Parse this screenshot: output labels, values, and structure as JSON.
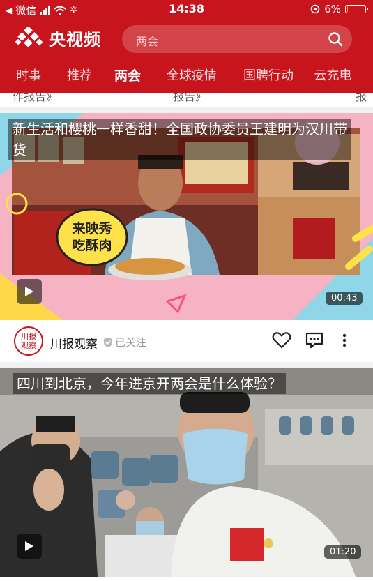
{
  "status_bar": {
    "carrier": "微信",
    "time": "14:38",
    "battery_text": "6%",
    "battery_level_percent": 6
  },
  "header": {
    "app_name": "央视频",
    "search_placeholder": "两会",
    "brand_color": "#c8141d"
  },
  "nav": {
    "tabs": [
      {
        "label": "时事",
        "active": false
      },
      {
        "label": "推荐",
        "active": false
      },
      {
        "label": "两会",
        "active": true
      },
      {
        "label": "全球疫情",
        "active": false
      },
      {
        "label": "国聘行动",
        "active": false
      },
      {
        "label": "云充电",
        "active": false
      }
    ]
  },
  "feed": {
    "partial_texts": [
      "作报告》",
      "报告》",
      "报"
    ],
    "video1": {
      "title": "新生活和樱桃一样香甜！全国政协委员王建明为汉川带货",
      "sticker": "来映秀吃酥肉",
      "duration": "00:43"
    },
    "channel": {
      "name": "川报观察",
      "avatar_text": "川报观察",
      "follow_status": "已关注"
    },
    "video2": {
      "title": "四川到北京，今年进京开两会是什么体验？",
      "duration": "01:20"
    }
  }
}
